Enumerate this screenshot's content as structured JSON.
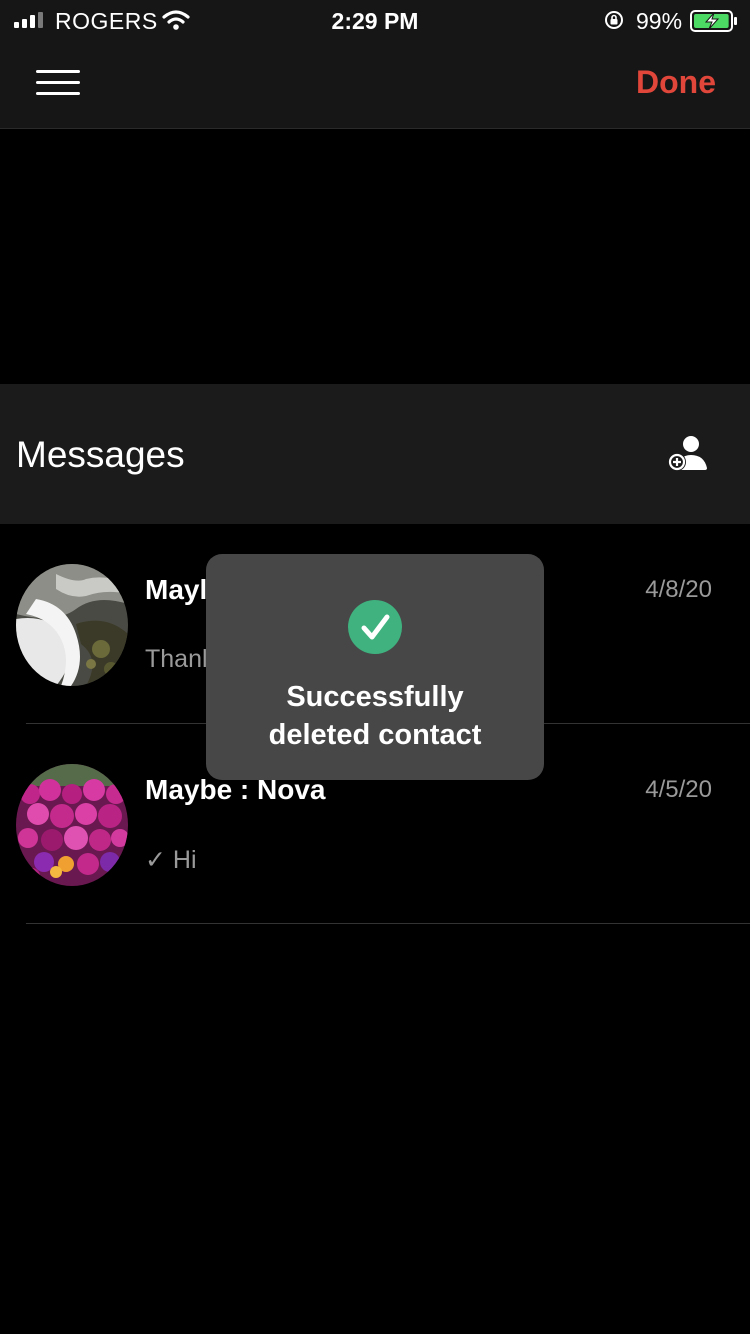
{
  "status_bar": {
    "carrier": "ROGERS",
    "time": "2:29 PM",
    "battery_percent": "99%",
    "signal_icon": "signal-bars-icon",
    "wifi_icon": "wifi-icon",
    "lock_icon": "rotation-lock-icon",
    "battery_icon": "battery-charging-icon",
    "battery_level": 0.99
  },
  "nav": {
    "menu_icon": "hamburger-menu-icon",
    "done_label": "Done"
  },
  "messages": {
    "title": "Messages",
    "add_icon": "add-contact-icon",
    "rows": [
      {
        "name": "Mayl",
        "date": "4/8/20",
        "preview": "Thanl",
        "avatar": "waterfall-photo"
      },
      {
        "name": "Maybe : Nova",
        "date": "4/5/20",
        "preview": "✓ Hi",
        "avatar": "flowers-photo"
      }
    ]
  },
  "toast": {
    "icon": "checkmark-circle-icon",
    "line1": "Successfully",
    "line2": "deleted contact"
  },
  "colors": {
    "accent": "#e0463a",
    "bar_background": "#161616",
    "header_background": "#1b1b1b",
    "toast_background": "#474747",
    "success_green": "#3fb27f",
    "battery_green": "#4cd964",
    "secondary_text": "#9a9a9a"
  }
}
